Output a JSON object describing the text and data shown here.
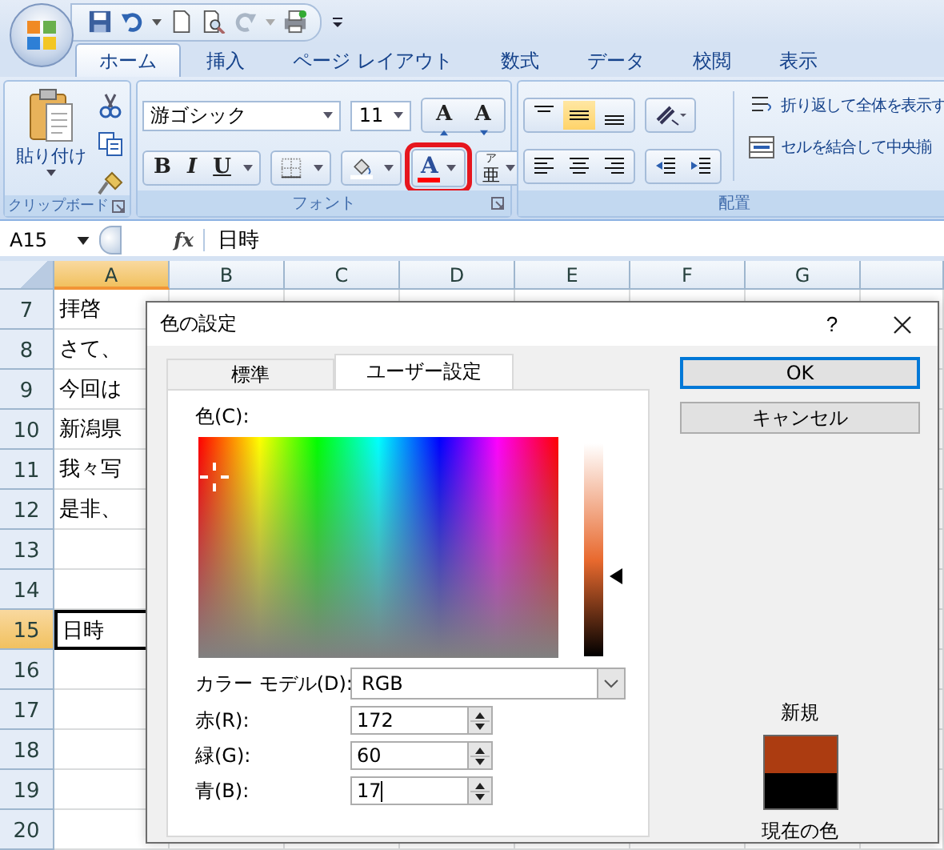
{
  "ribbon_tabs": [
    {
      "label": "ホーム",
      "selected": true
    },
    {
      "label": "挿入",
      "selected": false
    },
    {
      "label": "ページ レイアウト",
      "selected": false
    },
    {
      "label": "数式",
      "selected": false
    },
    {
      "label": "データ",
      "selected": false
    },
    {
      "label": "校閲",
      "selected": false
    },
    {
      "label": "表示",
      "selected": false
    }
  ],
  "ribbon": {
    "clipboard": {
      "paste_label": "貼り付け",
      "group_label": "クリップボード"
    },
    "font": {
      "font_name": "游ゴシック",
      "font_size": "11",
      "grow_label": "A",
      "shrink_label": "A",
      "bold_label": "B",
      "italic_label": "I",
      "underline_label": "U",
      "font_color_label": "A",
      "font_color_highlighted": true,
      "phonetic_label": "亜",
      "phonetic_ruby": "ア",
      "group_label": "フォント"
    },
    "alignment": {
      "vertical": [
        {
          "kind": "top",
          "selected": false
        },
        {
          "kind": "middle",
          "selected": true
        },
        {
          "kind": "bottom",
          "selected": false
        }
      ],
      "wrap_text": "折り返して全体を表示す",
      "merge": "セルを結合して中央揃",
      "group_label": "配置"
    }
  },
  "formula_bar": {
    "name_box": "A15",
    "function_label": "fx",
    "formula": "日時"
  },
  "sheet": {
    "columns": [
      {
        "label": "A",
        "selected": true
      },
      {
        "label": "B",
        "selected": false
      },
      {
        "label": "C",
        "selected": false
      },
      {
        "label": "D",
        "selected": false
      },
      {
        "label": "E",
        "selected": false
      },
      {
        "label": "F",
        "selected": false
      },
      {
        "label": "G",
        "selected": false
      }
    ],
    "rows": [
      {
        "label": "7",
        "selected": false,
        "cell_a": "拝啓　"
      },
      {
        "label": "8",
        "selected": false,
        "cell_a": "さて、"
      },
      {
        "label": "9",
        "selected": false,
        "cell_a": "今回は"
      },
      {
        "label": "10",
        "selected": false,
        "cell_a": "新潟県"
      },
      {
        "label": "11",
        "selected": false,
        "cell_a": "我々写"
      },
      {
        "label": "12",
        "selected": false,
        "cell_a": "是非、"
      },
      {
        "label": "13",
        "selected": false
      },
      {
        "label": "14",
        "selected": false
      },
      {
        "label": "15",
        "selected": true,
        "cell_a": "日時"
      },
      {
        "label": "16",
        "selected": false
      },
      {
        "label": "17",
        "selected": false
      },
      {
        "label": "18",
        "selected": false
      },
      {
        "label": "19",
        "selected": false
      },
      {
        "label": "20",
        "selected": false
      }
    ]
  },
  "dialog": {
    "title": "色の設定",
    "help": "?",
    "tabs": [
      {
        "label": "標準",
        "selected": false
      },
      {
        "label": "ユーザー設定",
        "selected": true
      }
    ],
    "color_label": "色(C):",
    "luminance": {
      "level": 0.38
    },
    "color_model_label": "カラー モデル(D):",
    "color_model": "RGB",
    "channels": [
      {
        "label": "赤(R):",
        "value": "172"
      },
      {
        "label": "緑(G):",
        "value": "60"
      },
      {
        "label": "青(B):",
        "value": "17"
      }
    ],
    "buttons": [
      {
        "label": "OK",
        "default": true
      },
      {
        "label": "キャンセル",
        "default": false
      }
    ],
    "swatches": [
      {
        "label": "新規",
        "color": "#ac3c11"
      },
      {
        "label": "現在の色",
        "color": "#000000"
      }
    ]
  }
}
